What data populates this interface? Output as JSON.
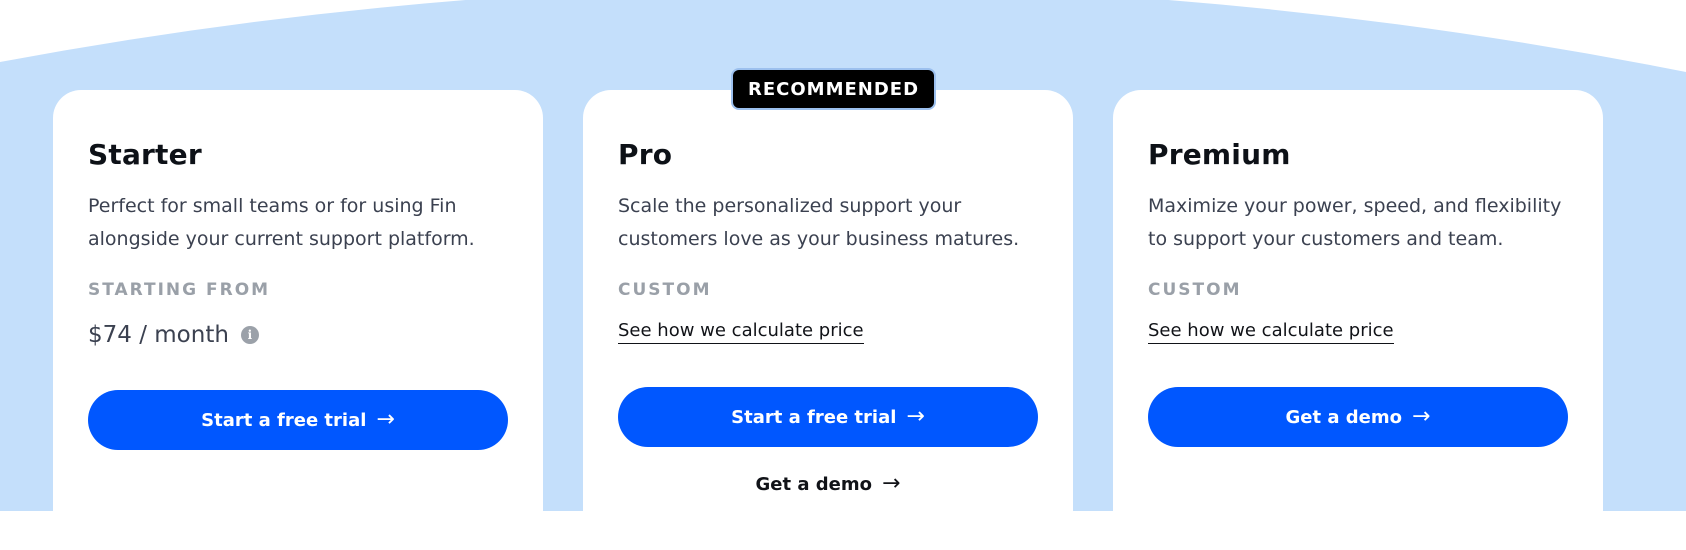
{
  "theme": {
    "accent": "#0057ff",
    "background_arc": "#c4dffb",
    "badge_bg": "#000000",
    "muted_label": "#9aa0a8"
  },
  "plans": [
    {
      "name": "Starter",
      "description": "Perfect for small teams or for using Fin alongside your current support platform.",
      "price_label": "STARTING FROM",
      "price": "$74 / month",
      "info_icon": "info-icon",
      "cta_label": "Start a free trial",
      "cta_icon": "arrow-right-icon"
    },
    {
      "name": "Pro",
      "badge": "RECOMMENDED",
      "description": "Scale the personalized support your customers love as your business matures.",
      "price_label": "CUSTOM",
      "price_link": "See how we calculate price",
      "cta_label": "Start a free trial",
      "cta_icon": "arrow-right-icon",
      "secondary_label": "Get a demo",
      "secondary_icon": "arrow-right-icon"
    },
    {
      "name": "Premium",
      "description": "Maximize your power, speed, and flexibility to support your customers and team.",
      "price_label": "CUSTOM",
      "price_link": "See how we calculate price",
      "cta_label": "Get a demo",
      "cta_icon": "arrow-right-icon"
    }
  ]
}
